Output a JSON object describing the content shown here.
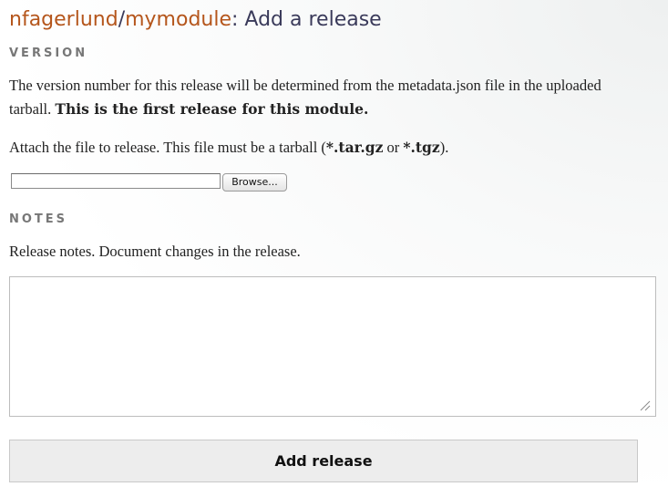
{
  "header": {
    "owner": "nfagerlund",
    "separator": "/",
    "module": "mymodule",
    "suffix": ": Add a release"
  },
  "version_section": {
    "heading": "VERSION",
    "description_plain": "The version number for this release will be determined from the metadata.json file in the uploaded tarball. ",
    "description_bold": "This is the first release for this module.",
    "attach_prefix": "Attach the file to release. This file must be a tarball (",
    "ext1": "*.tar.gz",
    "attach_mid": " or ",
    "ext2": "*.tgz",
    "attach_suffix": ").",
    "file_input_value": "",
    "browse_label": "Browse..."
  },
  "notes_section": {
    "heading": "NOTES",
    "description": "Release notes. Document changes in the release.",
    "textarea_value": ""
  },
  "submit": {
    "label": "Add release"
  },
  "colors": {
    "link": "#b5561c",
    "title": "#3a3a5a",
    "section_heading": "#777777"
  },
  "icons": {
    "resize_grip": "resize-grip-icon"
  }
}
